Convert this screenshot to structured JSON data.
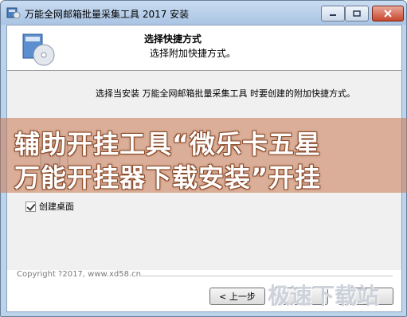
{
  "window": {
    "title": "万能全网邮箱批量采集工具 2017 安装",
    "controls": [
      "minimize-icon",
      "maximize-icon",
      "close-icon"
    ]
  },
  "header": {
    "title": "选择快捷方式",
    "subtitle": "选择附加快捷方式。"
  },
  "body": {
    "description": "选择当安装 万能全网邮箱批量采集工具 时要创建的附加快捷方式。",
    "checkbox": {
      "label": "创建桌面",
      "checked": true
    }
  },
  "footer": {
    "copyright": "Copyright ?2017, www.xd58.cn",
    "buttons": {
      "back": "< 上一步",
      "next": "",
      "cancel": ""
    }
  },
  "watermark": {
    "line1": "辅助开挂工具“微乐卡五星",
    "line2": "万能开挂器下载安装”开挂",
    "site": "极速下载站"
  },
  "colors": {
    "titlebar": "#bcd3ec",
    "close_button": "#c7442c",
    "overlay": "#c87850"
  }
}
